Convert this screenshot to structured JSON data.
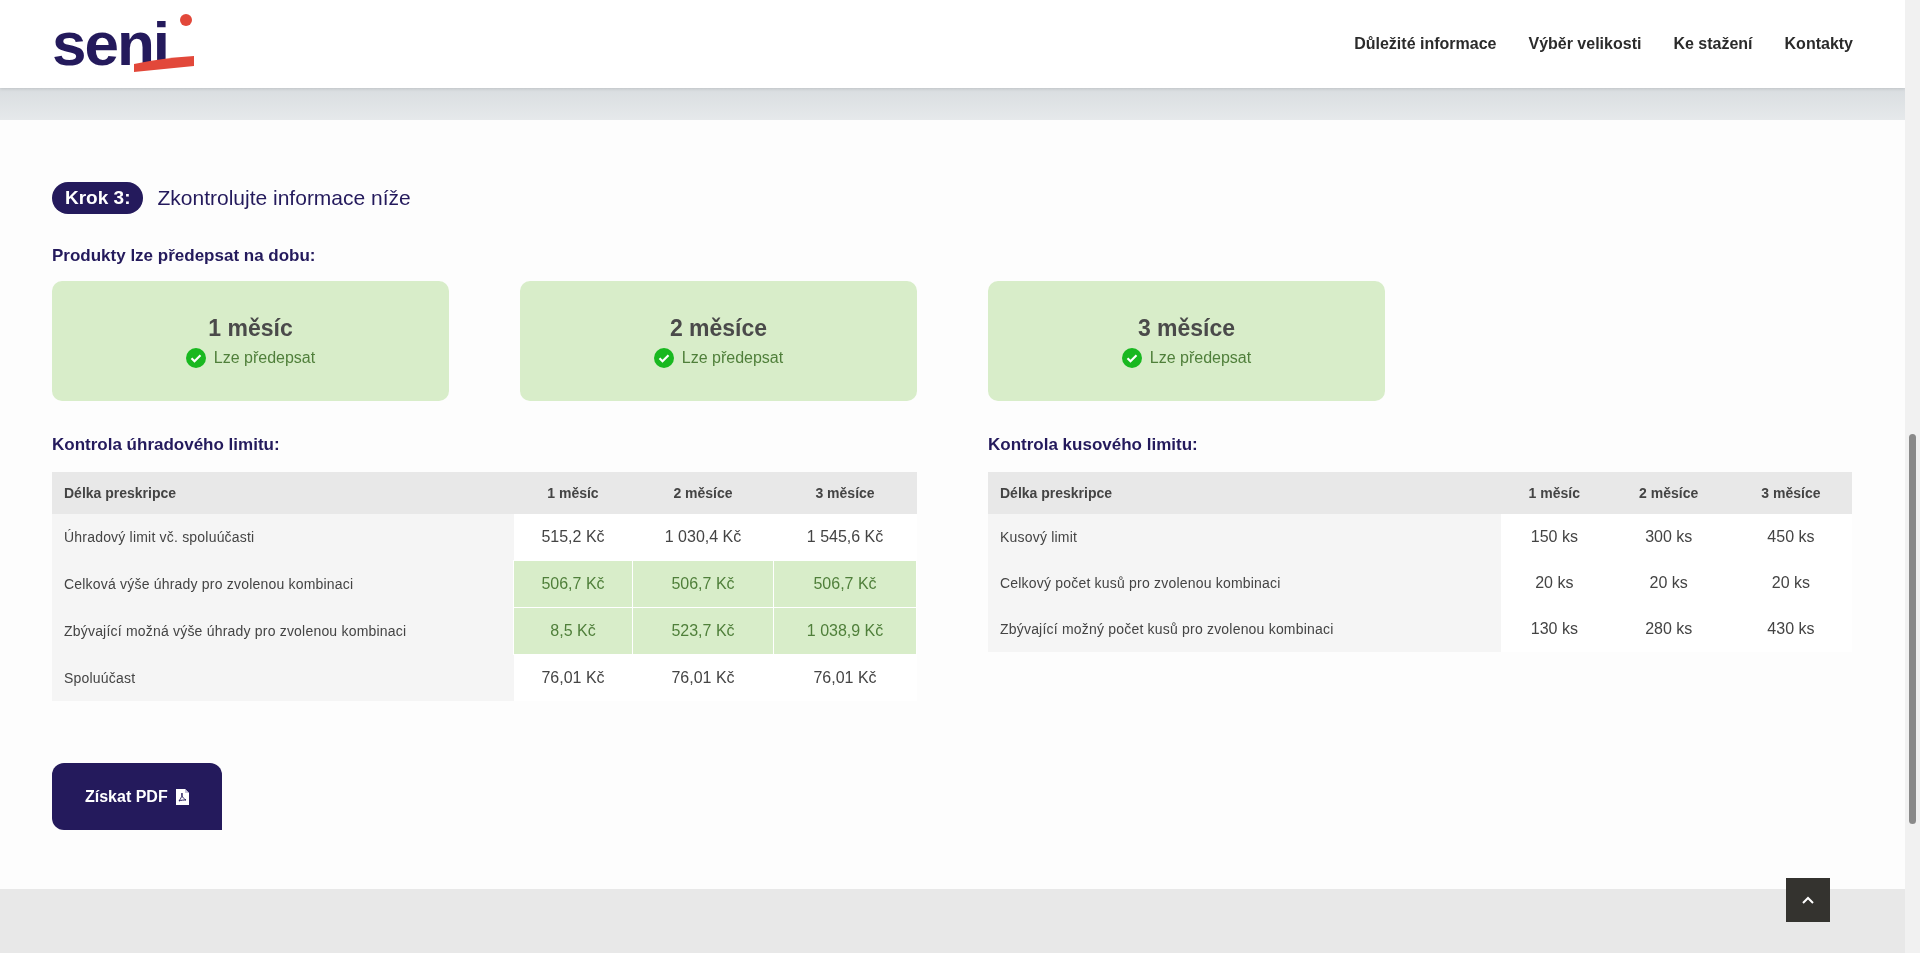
{
  "header": {
    "logo": "seni",
    "nav": [
      {
        "label": "Důležité informace"
      },
      {
        "label": "Výběr velikosti"
      },
      {
        "label": "Ke stažení"
      },
      {
        "label": "Kontakty"
      }
    ]
  },
  "step": {
    "badge": "Krok 3:",
    "title": "Zkontrolujte informace níže"
  },
  "products": {
    "heading": "Produkty lze předepsat na dobu:",
    "cards": [
      {
        "period": "1 měsíc",
        "status": "Lze předepsat",
        "available": true
      },
      {
        "period": "2 měsíce",
        "status": "Lze předepsat",
        "available": true
      },
      {
        "period": "3 měsíce",
        "status": "Lze předepsat",
        "available": true
      }
    ]
  },
  "tables": [
    {
      "title": "Kontrola úhradového limitu:",
      "label_column": "Délka preskripce",
      "columns": [
        "1 měsíc",
        "2 měsíce",
        "3 měsíce"
      ],
      "rows": [
        {
          "label": "Úhradový limit vč. spoluúčasti",
          "cells": [
            {
              "text": "515,2 Kč",
              "highlighted": false
            },
            {
              "text": "1 030,4 Kč",
              "highlighted": false
            },
            {
              "text": "1 545,6 Kč",
              "highlighted": false
            }
          ]
        },
        {
          "label": "Celková výše úhrady pro zvolenou kombinaci",
          "cells": [
            {
              "text": "506,7 Kč",
              "highlighted": true
            },
            {
              "text": "506,7 Kč",
              "highlighted": true
            },
            {
              "text": "506,7 Kč",
              "highlighted": true
            }
          ]
        },
        {
          "label": "Zbývající možná výše úhrady pro zvolenou kombinaci",
          "cells": [
            {
              "text": "8,5 Kč",
              "highlighted": true
            },
            {
              "text": "523,7 Kč",
              "highlighted": true
            },
            {
              "text": "1 038,9 Kč",
              "highlighted": true
            }
          ]
        },
        {
          "label": "Spoluúčast",
          "cells": [
            {
              "text": "76,01 Kč",
              "highlighted": false
            },
            {
              "text": "76,01 Kč",
              "highlighted": false
            },
            {
              "text": "76,01 Kč",
              "highlighted": false
            }
          ]
        }
      ]
    },
    {
      "title": "Kontrola kusového limitu:",
      "label_column": "Délka preskripce",
      "columns": [
        "1 měsíc",
        "2 měsíce",
        "3 měsíce"
      ],
      "rows": [
        {
          "label": "Kusový limit",
          "cells": [
            {
              "text": "150 ks",
              "highlighted": false
            },
            {
              "text": "300 ks",
              "highlighted": false
            },
            {
              "text": "450 ks",
              "highlighted": false
            }
          ]
        },
        {
          "label": "Celkový počet kusů pro zvolenou kombinaci",
          "cells": [
            {
              "text": "20 ks",
              "highlighted": false
            },
            {
              "text": "20 ks",
              "highlighted": false
            },
            {
              "text": "20 ks",
              "highlighted": false
            }
          ]
        },
        {
          "label": "Zbývající možný počet kusů pro zvolenou kombinaci",
          "cells": [
            {
              "text": "130 ks",
              "highlighted": false
            },
            {
              "text": "280 ks",
              "highlighted": false
            },
            {
              "text": "430 ks",
              "highlighted": false
            }
          ]
        }
      ]
    }
  ],
  "pdf_button": {
    "label": "Získat PDF"
  }
}
